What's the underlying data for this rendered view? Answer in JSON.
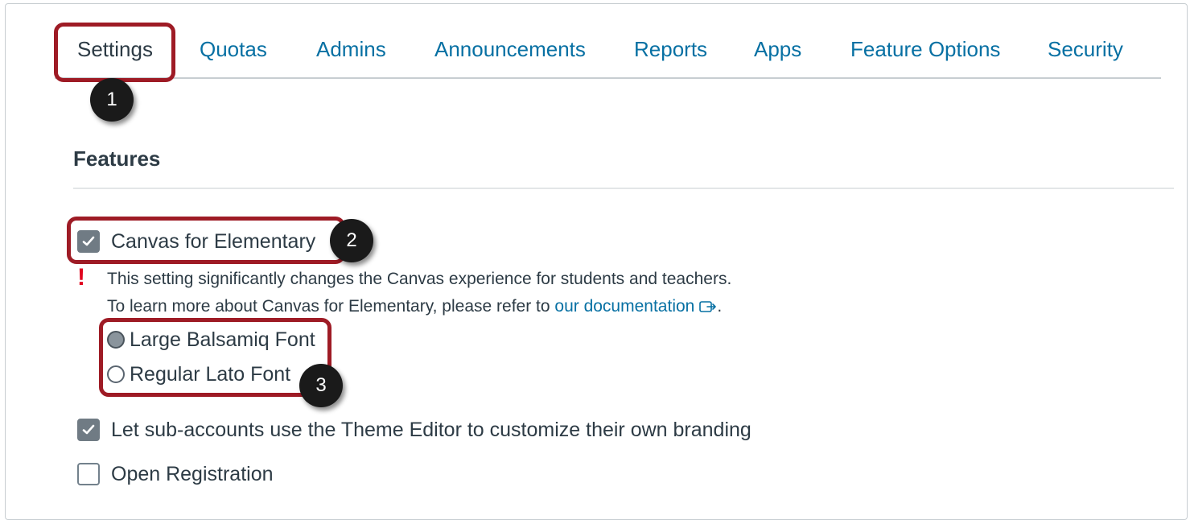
{
  "tabs": [
    {
      "label": "Settings",
      "active": true
    },
    {
      "label": "Quotas",
      "active": false
    },
    {
      "label": "Admins",
      "active": false
    },
    {
      "label": "Announcements",
      "active": false
    },
    {
      "label": "Reports",
      "active": false
    },
    {
      "label": "Apps",
      "active": false
    },
    {
      "label": "Feature Options",
      "active": false
    },
    {
      "label": "Security",
      "active": false
    }
  ],
  "callouts": [
    "1",
    "2",
    "3"
  ],
  "features": {
    "title": "Features",
    "canvas_for_elementary": {
      "label": "Canvas for Elementary",
      "checked": true,
      "warning_icon": "!",
      "warning_line1": "This setting significantly changes the Canvas experience for students and teachers.",
      "warning_line2_prefix": "To learn more about Canvas for Elementary, please refer to ",
      "doc_link": "our documentation",
      "warning_line2_suffix": ".",
      "font_options": [
        {
          "label": "Large Balsamiq Font",
          "selected": true
        },
        {
          "label": "Regular Lato Font",
          "selected": false
        }
      ]
    },
    "theme_editor": {
      "label": "Let sub-accounts use the Theme Editor to customize their own branding",
      "checked": true
    },
    "open_registration": {
      "label": "Open Registration",
      "checked": false
    }
  },
  "colors": {
    "link": "#0770a3",
    "text": "#2d3b45",
    "callout": "#9e1b25",
    "warning": "#e0061f"
  }
}
